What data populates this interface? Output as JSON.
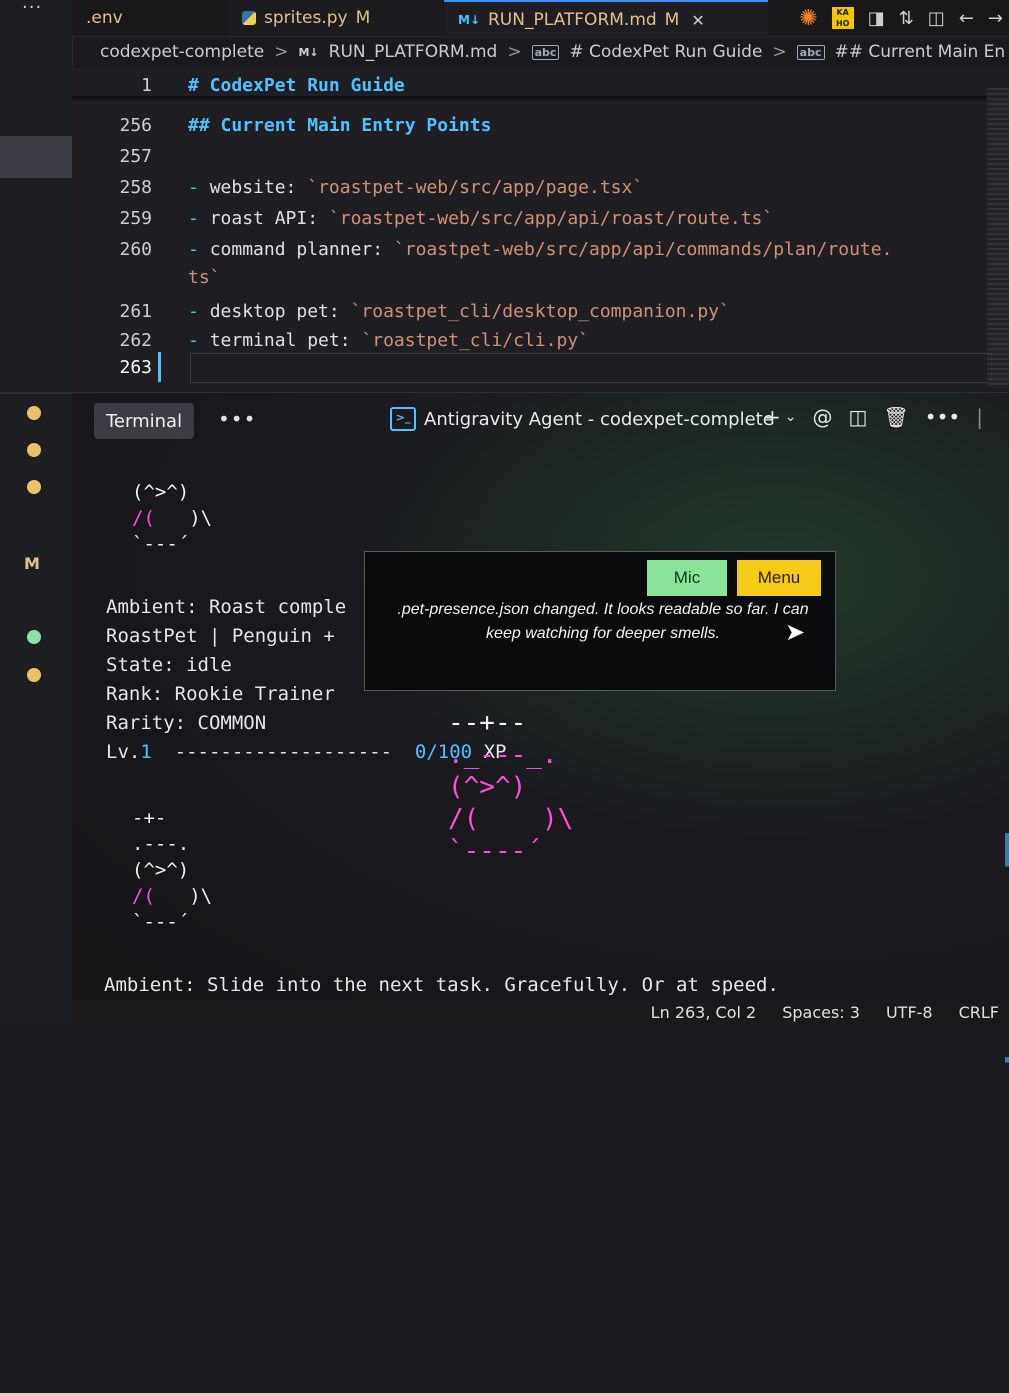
{
  "activity": {
    "overflow": "...",
    "dot_colors": [
      "#e8c36a",
      "#e8c36a",
      "#e8c36a",
      "#8de0a8",
      "#e8c36a"
    ],
    "badge": "M"
  },
  "tabs": [
    {
      "label": ".env",
      "active": false
    },
    {
      "label": "sprites.py",
      "modified": "M",
      "active": false
    },
    {
      "label": "RUN_PLATFORM.md",
      "icon": "M↓",
      "modified": "M",
      "active": true,
      "close": "✕"
    }
  ],
  "breadcrumb": {
    "folder": "codexpet-complete",
    "file_icon": "M↓",
    "file": "RUN_PLATFORM.md",
    "section1": "# CodexPet Run Guide",
    "section2": "## Current Main En"
  },
  "editor": {
    "sticky": {
      "num": "1",
      "text": "# CodexPet Run Guide"
    },
    "lines": [
      {
        "num": "256",
        "heading": "## Current Main Entry Points"
      },
      {
        "num": "257"
      },
      {
        "num": "258",
        "label": "website: ",
        "path": "`roastpet-web/src/app/page.tsx`"
      },
      {
        "num": "259",
        "label": "roast API: ",
        "path": "`roastpet-web/src/app/api/roast/route.ts`"
      },
      {
        "num": "260",
        "label": "command planner: ",
        "path": "`roastpet-web/src/app/api/commands/plan/route.",
        "wrap": "ts`"
      },
      {
        "num": "261",
        "label": "desktop pet: ",
        "path": "`roastpet_cli/desktop_companion.py`"
      },
      {
        "num": "262",
        "label": "terminal pet: ",
        "path": "`roastpet_cli/cli.py`"
      },
      {
        "num": "263"
      }
    ],
    "bullet": "-"
  },
  "panel": {
    "terminal_tab": "Terminal",
    "more": "•••",
    "agent_tab": "Antigravity Agent - codexpet-complete",
    "actions": {
      "add": "+",
      "chevron": "⌄",
      "at": "@",
      "split": "◫",
      "trash": "🗑",
      "more": "•••",
      "bar": "|"
    }
  },
  "terminal": {
    "small_pet": {
      "l1": "(^>^)",
      "l2a": "/(",
      "l2b": "   )\\",
      "l3": "`---´"
    },
    "info": {
      "ambient1": "Ambient: Roast comple",
      "roastpet": "RoastPet | Penguin +",
      "state": "State: idle",
      "rank": "Rank: Rookie Trainer",
      "rarity": "Rarity: COMMON",
      "lv_prefix": "Lv.",
      "lv": "1",
      "bar": "-------------------",
      "xp_cur": "0",
      "xp_max": "/100",
      "xp_unit": "XP"
    },
    "big_pet": {
      "hat": "--+--",
      "top": "._---_.",
      "face": "(^>^)",
      "body_l": "/(",
      "body_r": ")\\",
      "bottom": "`----´"
    },
    "mini_pet": {
      "hat": "-+-",
      "top": ".---.",
      "face": "(^>^)",
      "body_l": "/(",
      "body_r": ")\\",
      "bottom": "`---´"
    },
    "ambient2": "Ambient: Slide into the next task. Gracefully. Or at speed."
  },
  "popup": {
    "mic": "Mic",
    "menu": "Menu",
    "message": ".pet-presence.json changed. It looks readable so far. I can keep watching for deeper smells."
  },
  "status": {
    "position": "Ln 263, Col 2",
    "spaces": "Spaces: 3",
    "encoding": "UTF-8",
    "eol": "CRLF"
  }
}
